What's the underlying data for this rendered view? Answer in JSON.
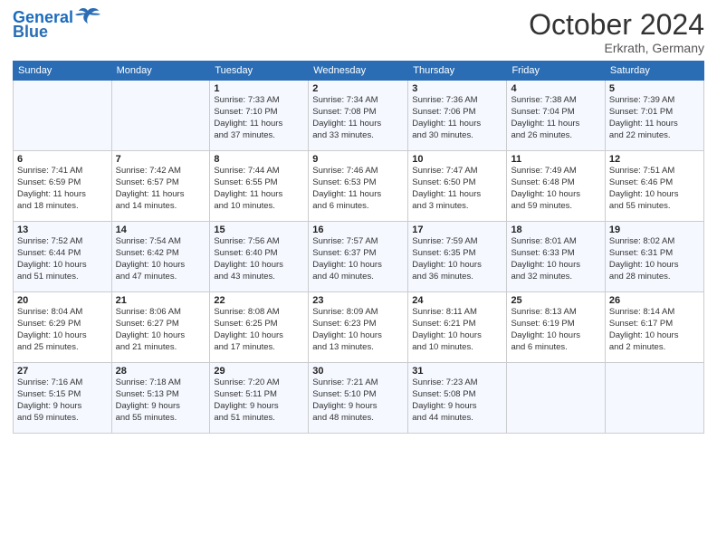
{
  "header": {
    "logo_line1": "General",
    "logo_line2": "Blue",
    "month": "October 2024",
    "location": "Erkrath, Germany"
  },
  "weekdays": [
    "Sunday",
    "Monday",
    "Tuesday",
    "Wednesday",
    "Thursday",
    "Friday",
    "Saturday"
  ],
  "weeks": [
    [
      {
        "day": "",
        "info": ""
      },
      {
        "day": "",
        "info": ""
      },
      {
        "day": "1",
        "info": "Sunrise: 7:33 AM\nSunset: 7:10 PM\nDaylight: 11 hours\nand 37 minutes."
      },
      {
        "day": "2",
        "info": "Sunrise: 7:34 AM\nSunset: 7:08 PM\nDaylight: 11 hours\nand 33 minutes."
      },
      {
        "day": "3",
        "info": "Sunrise: 7:36 AM\nSunset: 7:06 PM\nDaylight: 11 hours\nand 30 minutes."
      },
      {
        "day": "4",
        "info": "Sunrise: 7:38 AM\nSunset: 7:04 PM\nDaylight: 11 hours\nand 26 minutes."
      },
      {
        "day": "5",
        "info": "Sunrise: 7:39 AM\nSunset: 7:01 PM\nDaylight: 11 hours\nand 22 minutes."
      }
    ],
    [
      {
        "day": "6",
        "info": "Sunrise: 7:41 AM\nSunset: 6:59 PM\nDaylight: 11 hours\nand 18 minutes."
      },
      {
        "day": "7",
        "info": "Sunrise: 7:42 AM\nSunset: 6:57 PM\nDaylight: 11 hours\nand 14 minutes."
      },
      {
        "day": "8",
        "info": "Sunrise: 7:44 AM\nSunset: 6:55 PM\nDaylight: 11 hours\nand 10 minutes."
      },
      {
        "day": "9",
        "info": "Sunrise: 7:46 AM\nSunset: 6:53 PM\nDaylight: 11 hours\nand 6 minutes."
      },
      {
        "day": "10",
        "info": "Sunrise: 7:47 AM\nSunset: 6:50 PM\nDaylight: 11 hours\nand 3 minutes."
      },
      {
        "day": "11",
        "info": "Sunrise: 7:49 AM\nSunset: 6:48 PM\nDaylight: 10 hours\nand 59 minutes."
      },
      {
        "day": "12",
        "info": "Sunrise: 7:51 AM\nSunset: 6:46 PM\nDaylight: 10 hours\nand 55 minutes."
      }
    ],
    [
      {
        "day": "13",
        "info": "Sunrise: 7:52 AM\nSunset: 6:44 PM\nDaylight: 10 hours\nand 51 minutes."
      },
      {
        "day": "14",
        "info": "Sunrise: 7:54 AM\nSunset: 6:42 PM\nDaylight: 10 hours\nand 47 minutes."
      },
      {
        "day": "15",
        "info": "Sunrise: 7:56 AM\nSunset: 6:40 PM\nDaylight: 10 hours\nand 43 minutes."
      },
      {
        "day": "16",
        "info": "Sunrise: 7:57 AM\nSunset: 6:37 PM\nDaylight: 10 hours\nand 40 minutes."
      },
      {
        "day": "17",
        "info": "Sunrise: 7:59 AM\nSunset: 6:35 PM\nDaylight: 10 hours\nand 36 minutes."
      },
      {
        "day": "18",
        "info": "Sunrise: 8:01 AM\nSunset: 6:33 PM\nDaylight: 10 hours\nand 32 minutes."
      },
      {
        "day": "19",
        "info": "Sunrise: 8:02 AM\nSunset: 6:31 PM\nDaylight: 10 hours\nand 28 minutes."
      }
    ],
    [
      {
        "day": "20",
        "info": "Sunrise: 8:04 AM\nSunset: 6:29 PM\nDaylight: 10 hours\nand 25 minutes."
      },
      {
        "day": "21",
        "info": "Sunrise: 8:06 AM\nSunset: 6:27 PM\nDaylight: 10 hours\nand 21 minutes."
      },
      {
        "day": "22",
        "info": "Sunrise: 8:08 AM\nSunset: 6:25 PM\nDaylight: 10 hours\nand 17 minutes."
      },
      {
        "day": "23",
        "info": "Sunrise: 8:09 AM\nSunset: 6:23 PM\nDaylight: 10 hours\nand 13 minutes."
      },
      {
        "day": "24",
        "info": "Sunrise: 8:11 AM\nSunset: 6:21 PM\nDaylight: 10 hours\nand 10 minutes."
      },
      {
        "day": "25",
        "info": "Sunrise: 8:13 AM\nSunset: 6:19 PM\nDaylight: 10 hours\nand 6 minutes."
      },
      {
        "day": "26",
        "info": "Sunrise: 8:14 AM\nSunset: 6:17 PM\nDaylight: 10 hours\nand 2 minutes."
      }
    ],
    [
      {
        "day": "27",
        "info": "Sunrise: 7:16 AM\nSunset: 5:15 PM\nDaylight: 9 hours\nand 59 minutes."
      },
      {
        "day": "28",
        "info": "Sunrise: 7:18 AM\nSunset: 5:13 PM\nDaylight: 9 hours\nand 55 minutes."
      },
      {
        "day": "29",
        "info": "Sunrise: 7:20 AM\nSunset: 5:11 PM\nDaylight: 9 hours\nand 51 minutes."
      },
      {
        "day": "30",
        "info": "Sunrise: 7:21 AM\nSunset: 5:10 PM\nDaylight: 9 hours\nand 48 minutes."
      },
      {
        "day": "31",
        "info": "Sunrise: 7:23 AM\nSunset: 5:08 PM\nDaylight: 9 hours\nand 44 minutes."
      },
      {
        "day": "",
        "info": ""
      },
      {
        "day": "",
        "info": ""
      }
    ]
  ]
}
